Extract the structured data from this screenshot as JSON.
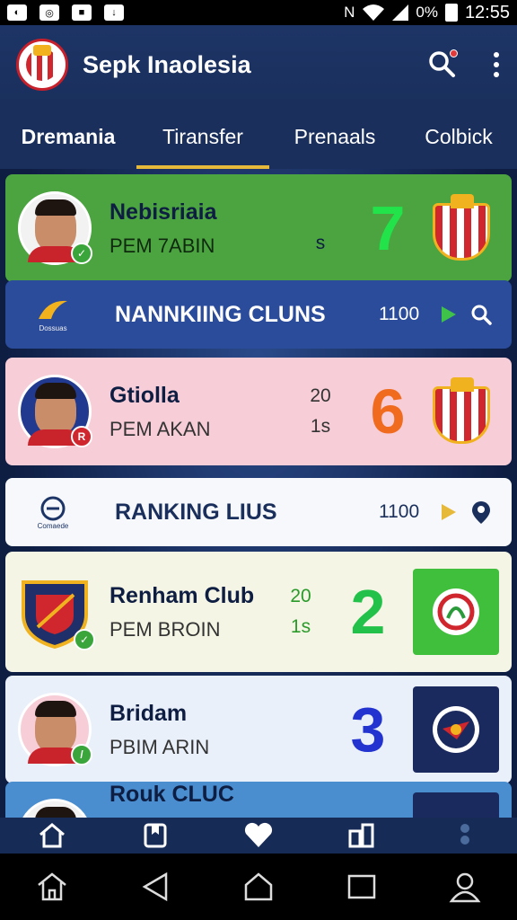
{
  "status_bar": {
    "battery_text": "0%",
    "time": "12:55"
  },
  "app_bar": {
    "title": "Sepk Inaolesia"
  },
  "tabs": [
    {
      "label": "Dremania",
      "active": false
    },
    {
      "label": "Tiransfer",
      "active": true
    },
    {
      "label": "Prenaals",
      "active": false
    },
    {
      "label": "Colbick",
      "active": false
    }
  ],
  "rows": {
    "p1": {
      "name": "Nebisriaia",
      "sub": "PEM 7ABIN",
      "stat_bottom": "s",
      "big": "7",
      "big_color": "#22c24a"
    },
    "r1": {
      "logo_text": "Dossuas",
      "title": "NANNKIING CLUNS",
      "number": "1100"
    },
    "p2": {
      "name": "Gtiolla",
      "sub": "PEM AKAN",
      "stat_top": "20",
      "stat_bottom": "1s",
      "big": "6",
      "big_color": "#f06b1e"
    },
    "r2": {
      "logo_text": "Comaede",
      "title": "RANKING LIUS",
      "number": "1100"
    },
    "p3": {
      "name": "Renham Club",
      "sub": "PEM BROIN",
      "stat_top": "20",
      "stat_bottom": "1s",
      "big": "2",
      "big_color": "#22c24a"
    },
    "p4": {
      "name": "Bridam",
      "sub": "PBIM ARIN",
      "big": "3",
      "big_color": "#2233d0"
    },
    "p5": {
      "name": "Rouk CLUC"
    }
  },
  "colors": {
    "appbar": "#1a2f5c",
    "tab_indicator": "#e7b93b",
    "card_green": "#4ba43f",
    "card_blue": "#2b4b9b",
    "card_pink": "#f7cdd8",
    "card_white": "#f6f8fb",
    "card_cream": "#f4f5e4",
    "card_light": "#eaf0fa"
  },
  "bottom_nav": [
    "home-icon",
    "bookmark-icon",
    "heart-icon",
    "stats-icon",
    "more-apps-icon"
  ],
  "system_nav": [
    "home-outline-icon",
    "back-icon",
    "home-icon",
    "recents-icon",
    "profile-icon"
  ]
}
